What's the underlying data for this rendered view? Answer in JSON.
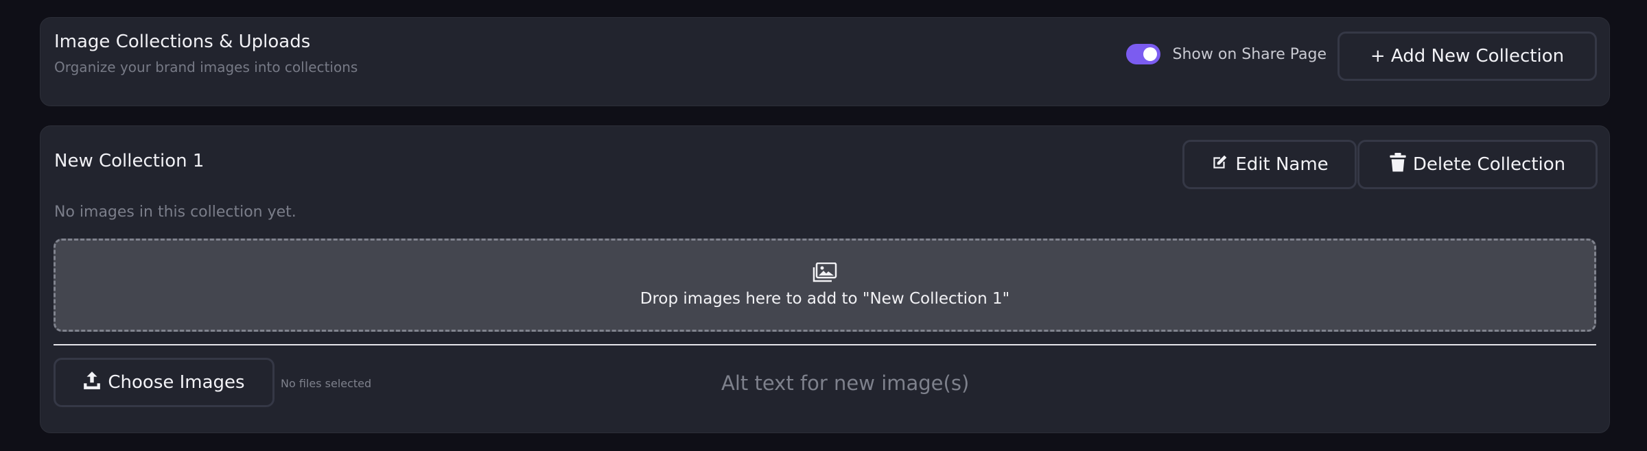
{
  "header": {
    "title": "Image Collections & Uploads",
    "subtitle": "Organize your brand images into collections",
    "share_toggle_label": "Show on Share Page",
    "share_toggle_on": true,
    "add_collection_label": "+ Add New Collection"
  },
  "collection": {
    "name": "New Collection 1",
    "edit_label": "Edit Name",
    "delete_label": "Delete Collection",
    "empty_message": "No images in this collection yet.",
    "dropzone_text": "Drop images here to add to \"New Collection 1\"",
    "choose_label": "Choose Images",
    "no_files_text": "No files selected",
    "alt_placeholder": "Alt text for new image(s)"
  },
  "icons": {
    "edit": "edit-icon",
    "delete": "trash-icon",
    "dropzone": "images-icon",
    "upload": "upload-icon"
  },
  "colors": {
    "accent": "#7b5cf0",
    "card": "#22242e",
    "background": "#0f0f17"
  }
}
